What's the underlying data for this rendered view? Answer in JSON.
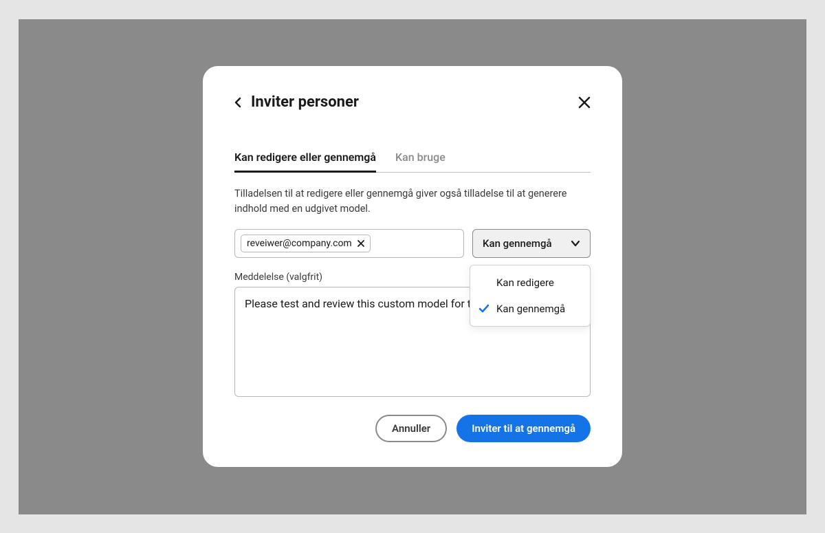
{
  "dialog": {
    "title": "Inviter personer",
    "tabs": [
      {
        "label": "Kan redigere eller gennemgå",
        "active": true
      },
      {
        "label": "Kan bruge",
        "active": false
      }
    ],
    "description": "Tilladelsen til at redigere eller gennemgå giver også tilladelse til at generere indhold med en udgivet model.",
    "email_chip": "reveiwer@company.com",
    "permission_selected": "Kan gennemgå",
    "permission_options": [
      {
        "label": "Kan redigere",
        "selected": false
      },
      {
        "label": "Kan gennemgå",
        "selected": true
      }
    ],
    "message_label": "Meddelelse (valgfrit)",
    "message_value": "Please test and review this custom model for the team.",
    "cancel_label": "Annuller",
    "submit_label": "Inviter til at gennemgå"
  }
}
